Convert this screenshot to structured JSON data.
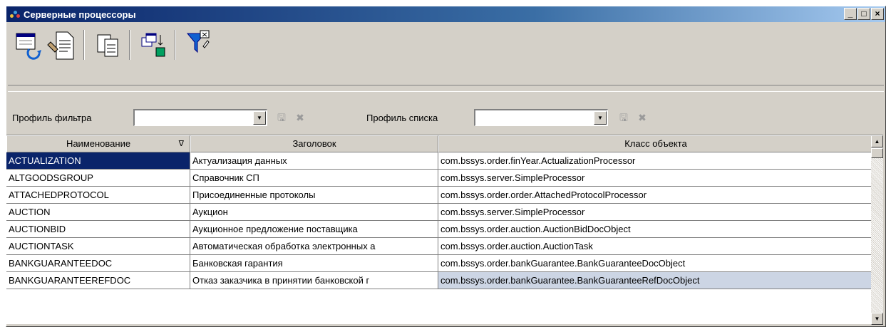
{
  "window": {
    "title": "Серверные процессоры"
  },
  "toolbar": {
    "icons": [
      "refresh-list-icon",
      "edit-document-icon",
      "copy-icon",
      "export-icon",
      "filter-clear-icon"
    ]
  },
  "filters": {
    "filter_profile_label": "Профиль фильтра",
    "filter_profile_value": "",
    "list_profile_label": "Профиль списка",
    "list_profile_value": ""
  },
  "grid": {
    "columns": [
      "Наименование",
      "Заголовок",
      "Класс объекта"
    ],
    "sort_indicator": "∇",
    "rows": [
      [
        "ACTUALIZATION",
        "Актуализация данных",
        "com.bssys.order.finYear.ActualizationProcessor"
      ],
      [
        "ALTGOODSGROUP",
        "Справочник СП",
        "com.bssys.server.SimpleProcessor"
      ],
      [
        "ATTACHEDPROTOCOL",
        "Присоединенные протоколы",
        "com.bssys.order.order.AttachedProtocolProcessor"
      ],
      [
        "AUCTION",
        "Аукцион",
        "com.bssys.server.SimpleProcessor"
      ],
      [
        "AUCTIONBID",
        "Аукционное предложение поставщика",
        "com.bssys.order.auction.AuctionBidDocObject"
      ],
      [
        "AUCTIONTASK",
        "Автоматическая обработка электронных а",
        "com.bssys.order.auction.AuctionTask"
      ],
      [
        "BANKGUARANTEEDOC",
        "Банковская гарантия",
        "com.bssys.order.bankGuarantee.BankGuaranteeDocObject"
      ],
      [
        "BANKGUARANTEEREFDOC",
        "Отказ заказчика в принятии банковской г",
        "com.bssys.order.bankGuarantee.BankGuaranteeRefDocObject"
      ]
    ],
    "selected_row": 0
  },
  "colors": {
    "title_start": "#0a246a",
    "title_end": "#a6caf0",
    "selection": "#0a246a",
    "highlight": "#ccd5e4"
  }
}
